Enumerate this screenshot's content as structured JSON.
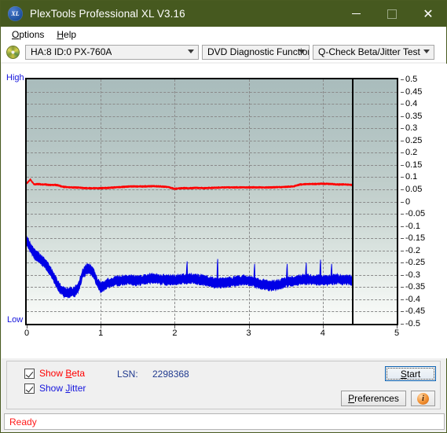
{
  "window": {
    "title": "PlexTools Professional XL V3.16",
    "app_icon": "xl-disc-icon",
    "minimize_label": "minimize-icon",
    "maximize_label": "maximize-icon",
    "close_label": "close-icon",
    "titlebar_color": "#46591f"
  },
  "menu": {
    "items": [
      {
        "label": "Options",
        "accel": "O"
      },
      {
        "label": "Help",
        "accel": "H"
      }
    ]
  },
  "toolbar": {
    "drive_combo": "HA:8 ID:0  PX-760A",
    "function_combo": "DVD Diagnostic Functions",
    "test_combo": "Q-Check Beta/Jitter Test"
  },
  "chart_data": {
    "type": "line",
    "title": "Q-Check Beta/Jitter Test",
    "xlabel": "",
    "ylabel": "",
    "xlim": [
      0,
      5
    ],
    "ylim": [
      -0.5,
      0.5
    ],
    "grid": true,
    "legend_position": "below-left",
    "xticks": [
      0,
      1,
      2,
      3,
      4,
      5
    ],
    "yticks": [
      0.5,
      0.45,
      0.4,
      0.35,
      0.3,
      0.25,
      0.2,
      0.15,
      0.1,
      0.05,
      0,
      -0.05,
      -0.1,
      -0.15,
      -0.2,
      -0.25,
      -0.3,
      -0.35,
      -0.4,
      -0.45,
      -0.5
    ],
    "axis_left_label": "High",
    "axis_left_label_bottom": "Low",
    "data_end_x": 4.4,
    "series": [
      {
        "name": "Show Beta",
        "color": "#ff0000",
        "x": [
          0.0,
          0.05,
          0.1,
          0.15,
          0.2,
          0.25,
          0.3,
          0.4,
          0.5,
          0.6,
          0.7,
          0.8,
          0.9,
          1.0,
          1.1,
          1.2,
          1.3,
          1.4,
          1.5,
          1.6,
          1.7,
          1.8,
          1.9,
          2.0,
          2.1,
          2.2,
          2.3,
          2.4,
          2.5,
          2.6,
          2.7,
          2.8,
          2.9,
          3.0,
          3.1,
          3.2,
          3.3,
          3.4,
          3.5,
          3.6,
          3.7,
          3.8,
          3.9,
          4.0,
          4.1,
          4.2,
          4.3,
          4.4
        ],
        "y": [
          0.075,
          0.09,
          0.07,
          0.072,
          0.07,
          0.07,
          0.068,
          0.068,
          0.06,
          0.058,
          0.057,
          0.055,
          0.055,
          0.055,
          0.056,
          0.058,
          0.06,
          0.062,
          0.062,
          0.062,
          0.063,
          0.062,
          0.06,
          0.052,
          0.055,
          0.055,
          0.056,
          0.055,
          0.056,
          0.057,
          0.058,
          0.058,
          0.058,
          0.058,
          0.058,
          0.058,
          0.058,
          0.059,
          0.06,
          0.062,
          0.07,
          0.072,
          0.072,
          0.073,
          0.072,
          0.07,
          0.07,
          0.068
        ],
        "noise": 0.004
      },
      {
        "name": "Show Jitter",
        "color": "#0000e6",
        "x": [
          0.0,
          0.05,
          0.1,
          0.15,
          0.2,
          0.25,
          0.3,
          0.35,
          0.4,
          0.45,
          0.5,
          0.55,
          0.6,
          0.65,
          0.7,
          0.75,
          0.8,
          0.85,
          0.9,
          0.95,
          1.0,
          1.1,
          1.2,
          1.3,
          1.4,
          1.5,
          1.6,
          1.7,
          1.8,
          1.9,
          2.0,
          2.1,
          2.2,
          2.3,
          2.4,
          2.5,
          2.6,
          2.7,
          2.8,
          2.9,
          3.0,
          3.1,
          3.2,
          3.3,
          3.4,
          3.5,
          3.6,
          3.7,
          3.8,
          3.9,
          4.0,
          4.1,
          4.2,
          4.3,
          4.4
        ],
        "y": [
          -0.16,
          -0.19,
          -0.215,
          -0.225,
          -0.24,
          -0.255,
          -0.275,
          -0.3,
          -0.33,
          -0.355,
          -0.37,
          -0.375,
          -0.37,
          -0.368,
          -0.35,
          -0.3,
          -0.278,
          -0.275,
          -0.29,
          -0.33,
          -0.352,
          -0.335,
          -0.325,
          -0.322,
          -0.32,
          -0.325,
          -0.318,
          -0.315,
          -0.318,
          -0.322,
          -0.32,
          -0.318,
          -0.315,
          -0.318,
          -0.322,
          -0.33,
          -0.335,
          -0.33,
          -0.328,
          -0.322,
          -0.325,
          -0.332,
          -0.34,
          -0.345,
          -0.34,
          -0.33,
          -0.325,
          -0.32,
          -0.318,
          -0.32,
          -0.322,
          -0.32,
          -0.318,
          -0.32,
          -0.322
        ],
        "noise": 0.022,
        "spikes": [
          {
            "x": 2.17,
            "y": -0.245
          },
          {
            "x": 2.58,
            "y": -0.235
          },
          {
            "x": 3.08,
            "y": -0.255
          },
          {
            "x": 3.52,
            "y": -0.255
          },
          {
            "x": 3.78,
            "y": -0.25
          },
          {
            "x": 3.97,
            "y": -0.238
          },
          {
            "x": 4.12,
            "y": -0.255
          }
        ]
      }
    ]
  },
  "controls": {
    "show_beta_label": "Show Beta",
    "show_beta_accel": "B",
    "show_beta_checked": true,
    "show_jitter_label": "Show Jitter",
    "show_jitter_accel": "J",
    "show_jitter_checked": true,
    "lsn_label": "LSN:",
    "lsn_value": "2298368",
    "start_label": "Start",
    "start_accel": "S",
    "preferences_label": "Preferences",
    "preferences_accel": "P",
    "info_icon": "info-icon"
  },
  "statusbar": {
    "text": "Ready"
  }
}
